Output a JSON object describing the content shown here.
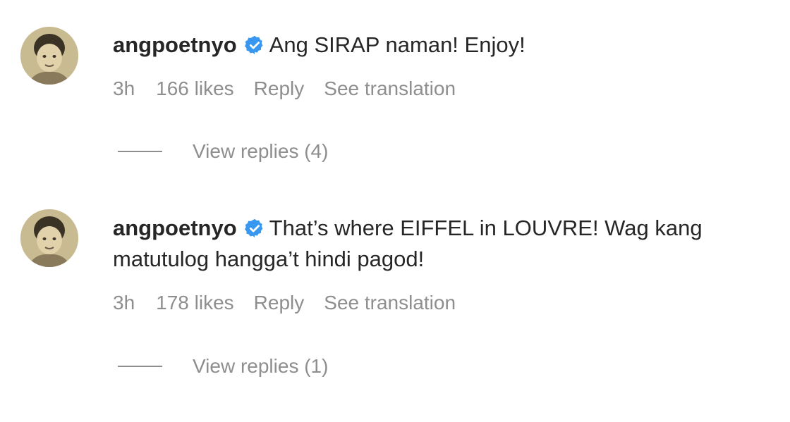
{
  "comments": [
    {
      "username": "angpoetnyo",
      "verified": true,
      "text": "Ang SIRAP naman! Enjoy!",
      "time": "3h",
      "likes": "166 likes",
      "reply_label": "Reply",
      "translation_label": "See translation",
      "view_replies": "View replies (4)"
    },
    {
      "username": "angpoetnyo",
      "verified": true,
      "text": "That’s where EIFFEL in LOUVRE! Wag kang matutulog hangga’t hindi pagod!",
      "time": "3h",
      "likes": "178 likes",
      "reply_label": "Reply",
      "translation_label": "See translation",
      "view_replies": "View replies (1)"
    }
  ],
  "colors": {
    "text": "#262626",
    "secondary": "#8e8e8e",
    "verified_badge": "#3897f0"
  },
  "icons": {
    "verified": "verified-badge-icon",
    "avatar": "user-avatar"
  }
}
